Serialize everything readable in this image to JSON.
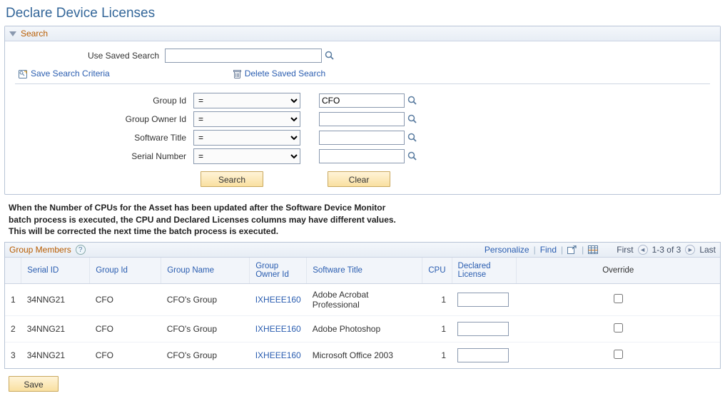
{
  "page_title": "Declare Device Licenses",
  "search_panel": {
    "header": "Search",
    "use_saved_label": "Use Saved Search",
    "saved_value": "",
    "save_criteria": "Save Search Criteria",
    "delete_saved": "Delete Saved Search",
    "buttons": {
      "search": "Search",
      "clear": "Clear"
    },
    "criteria": [
      {
        "label": "Group Id",
        "op": "=",
        "value": "CFO"
      },
      {
        "label": "Group Owner Id",
        "op": "=",
        "value": ""
      },
      {
        "label": "Software Title",
        "op": "=",
        "value": ""
      },
      {
        "label": "Serial Number",
        "op": "=",
        "value": ""
      }
    ]
  },
  "info_text": {
    "l1": "When the Number of CPUs for the Asset has been updated after the Software Device Monitor",
    "l2": "batch process is executed, the CPU and Declared Licenses columns may have different values.",
    "l3": "This will be corrected the next time the batch process is executed."
  },
  "grid": {
    "title": "Group Members",
    "toolbar": {
      "personalize": "Personalize",
      "find": "Find",
      "first": "First",
      "range": "1-3 of 3",
      "last": "Last"
    },
    "columns": {
      "row": "",
      "serial": "Serial ID",
      "group_id": "Group Id",
      "group_name": "Group Name",
      "owner": "Group Owner Id",
      "title": "Software Title",
      "cpu": "CPU",
      "declared": "Declared License",
      "override": "Override"
    },
    "rows": [
      {
        "n": "1",
        "serial": "34NNG21",
        "group_id": "CFO",
        "group_name": "CFO's Group",
        "owner": "IXHEEE160",
        "title": "Adobe Acrobat Professional",
        "cpu": "1",
        "declared": "",
        "override": false
      },
      {
        "n": "2",
        "serial": "34NNG21",
        "group_id": "CFO",
        "group_name": "CFO's Group",
        "owner": "IXHEEE160",
        "title": "Adobe Photoshop",
        "cpu": "1",
        "declared": "",
        "override": false
      },
      {
        "n": "3",
        "serial": "34NNG21",
        "group_id": "CFO",
        "group_name": "CFO's Group",
        "owner": "IXHEEE160",
        "title": "Microsoft Office 2003",
        "cpu": "1",
        "declared": "",
        "override": false
      }
    ]
  },
  "save_button": "Save"
}
